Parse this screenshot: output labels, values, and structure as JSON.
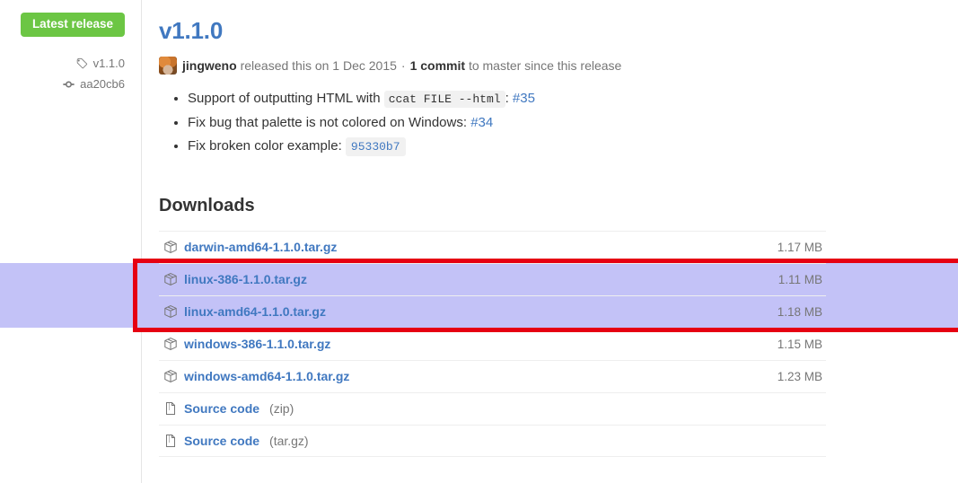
{
  "sidebar": {
    "badge_label": "Latest release",
    "tag": {
      "icon": "tag-icon",
      "label": "v1.1.0"
    },
    "commit": {
      "icon": "git-commit-icon",
      "label": "aa20cb6"
    }
  },
  "release": {
    "title": "v1.1.0",
    "author": "jingweno",
    "released_text": "released this on",
    "date": "1 Dec 2015",
    "separator": "·",
    "commit_count": "1 commit",
    "commit_suffix": "to master since this release",
    "notes": [
      {
        "text_before": "Support of outputting HTML with",
        "code": "ccat FILE --html",
        "text_middle": ":",
        "link": "#35",
        "text_after": ""
      },
      {
        "text_before": "Fix bug that palette is not colored on Windows:",
        "code": "",
        "text_middle": "",
        "link": "#34",
        "text_after": ""
      },
      {
        "text_before": "Fix broken color example:",
        "code": "",
        "text_middle": "",
        "link": "",
        "sha": "95330b7",
        "text_after": ""
      }
    ]
  },
  "downloads": {
    "heading": "Downloads",
    "rows": [
      {
        "icon": "package-icon",
        "name": "darwin-amd64-1.1.0.tar.gz",
        "suffix": "",
        "size": "1.17 MB",
        "selected": false
      },
      {
        "icon": "package-icon",
        "name": "linux-386-1.1.0.tar.gz",
        "suffix": "",
        "size": "1.11 MB",
        "selected": true
      },
      {
        "icon": "package-icon",
        "name": "linux-amd64-1.1.0.tar.gz",
        "suffix": "",
        "size": "1.18 MB",
        "selected": true
      },
      {
        "icon": "package-icon",
        "name": "windows-386-1.1.0.tar.gz",
        "suffix": "",
        "size": "1.15 MB",
        "selected": false
      },
      {
        "icon": "package-icon",
        "name": "windows-amd64-1.1.0.tar.gz",
        "suffix": "",
        "size": "1.23 MB",
        "selected": false
      },
      {
        "icon": "file-zip-icon",
        "name": "Source code",
        "suffix": "(zip)",
        "size": "",
        "selected": false
      },
      {
        "icon": "file-zip-icon",
        "name": "Source code",
        "suffix": "(tar.gz)",
        "size": "",
        "selected": false
      }
    ]
  },
  "annotation": {
    "type": "red-rectangle-highlight",
    "color": "#e60012",
    "highlight_color": "#c3c2f7"
  },
  "colors": {
    "link": "#4078c0",
    "badge_green": "#6cc644",
    "muted": "#767676",
    "text": "#333333",
    "border": "#eeeeee"
  }
}
